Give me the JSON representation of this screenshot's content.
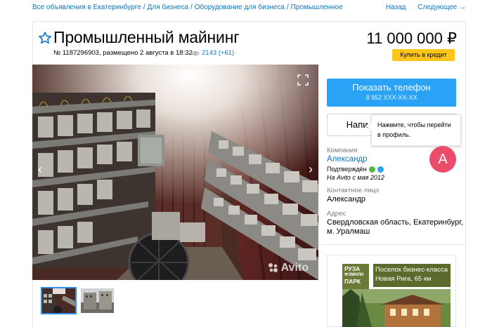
{
  "breadcrumbs": {
    "items": [
      "Все объявления в Екатеринбурге",
      "Для бизнеса",
      "Оборудование для бизнеса",
      "Промышленное"
    ],
    "separator": "/"
  },
  "pager": {
    "back": "Назад",
    "next": "Следующее →"
  },
  "listing": {
    "title": "Промышленный майнинг",
    "price": "11 000 000 ₽",
    "credit_button": "Купить в кредит",
    "meta": "№ 1187296903, размещено 2 августа в 18:32",
    "views": "2143 (+61)"
  },
  "photo": {
    "watermark": "Avito",
    "prev_arrow": "‹",
    "next_arrow": "›"
  },
  "contact": {
    "phone_label": "Показать телефон",
    "phone_number": "8 952 XXX-XX-XX",
    "message_button": "Написать сообщение",
    "tooltip": "Нажмите, чтобы перейти в профиль.",
    "avatar_letter": "A"
  },
  "seller": {
    "company_label": "Компания",
    "company_name": "Александр",
    "verified": "Подтверждён",
    "since": "На Avito с мая 2012",
    "contact_label": "Контактное лицо",
    "contact_name": "Александр",
    "address_label": "Адрес",
    "address_line1": "Свердловская область, Екатеринбург,",
    "address_line2": "м. Уралмаш"
  },
  "ad": {
    "logo": [
      "РУЗА",
      "ФЭМИЛИ",
      "ПАРК"
    ],
    "text_line1": "Поселок бизнес-класса",
    "text_line2": "Новая Рига, 65 км"
  },
  "colors": {
    "link": "#0a77c8",
    "phone_button": "#2aa2f5",
    "credit_button": "#ffc61a",
    "avatar": "#ec4b6a"
  }
}
